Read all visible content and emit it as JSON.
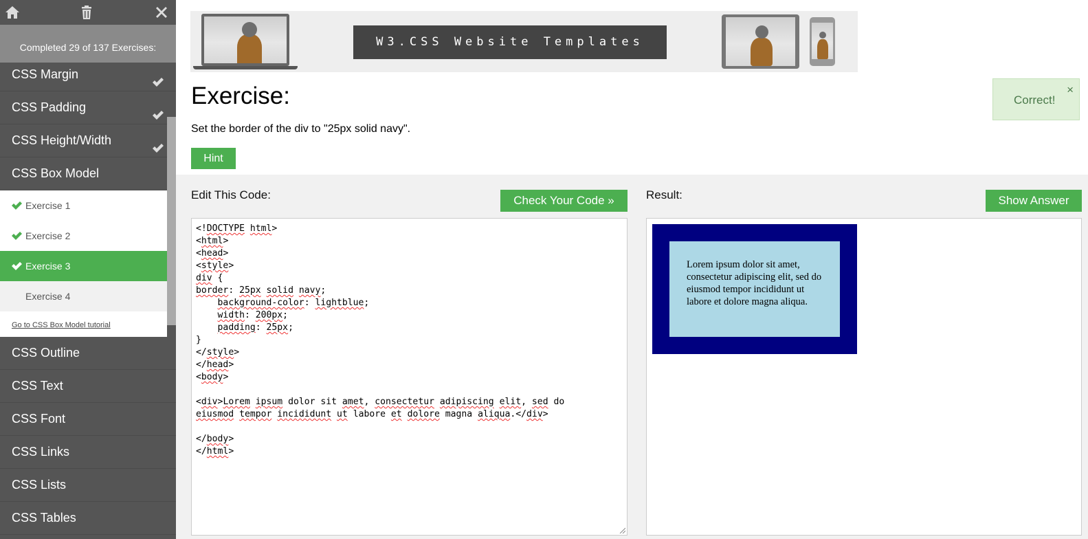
{
  "sidebar": {
    "progress_text": "Completed 29 of 137 Exercises:",
    "categories_top": [
      {
        "label": "CSS Margin",
        "done": true
      },
      {
        "label": "CSS Padding",
        "done": true
      },
      {
        "label": "CSS Height/Width",
        "done": true
      },
      {
        "label": "CSS Box Model",
        "done": false
      }
    ],
    "exercises": [
      {
        "label": "Exercise 1",
        "done": true
      },
      {
        "label": "Exercise 2",
        "done": true
      },
      {
        "label": "Exercise 3",
        "done": true,
        "current": true
      },
      {
        "label": "Exercise 4",
        "done": false
      }
    ],
    "tutorial_link": "Go to CSS Box Model tutorial",
    "categories_bottom": [
      {
        "label": "CSS Outline"
      },
      {
        "label": "CSS Text"
      },
      {
        "label": "CSS Font"
      },
      {
        "label": "CSS Links"
      },
      {
        "label": "CSS Lists"
      },
      {
        "label": "CSS Tables"
      }
    ]
  },
  "banner": {
    "title": "W3.CSS Website Templates"
  },
  "exercise": {
    "heading": "Exercise:",
    "description": "Set the border of the div to \"25px solid navy\".",
    "hint_label": "Hint"
  },
  "toast": {
    "text": "Correct!",
    "close": "×"
  },
  "editor": {
    "label": "Edit This Code:",
    "check_label": "Check Your Code »",
    "code_lines": [
      "<!DOCTYPE html>",
      "<html>",
      "<head>",
      "<style>",
      "div {",
      "border: 25px solid navy;",
      "    background-color: lightblue;",
      "    width: 200px;",
      "    padding: 25px;",
      "}",
      "</style>",
      "</head>",
      "<body>",
      "",
      "<div>Lorem ipsum dolor sit amet, consectetur adipiscing elit, sed do",
      "eiusmod tempor incididunt ut labore et dolore magna aliqua.</div>",
      "",
      "</body>",
      "</html>"
    ]
  },
  "result": {
    "label": "Result:",
    "answer_label": "Show Answer",
    "div_text": "Lorem ipsum dolor sit amet, consectetur adipiscing elit, sed do eiusmod tempor incididunt ut labore et dolore magna aliqua."
  },
  "colors": {
    "accent_green": "#4CAF50",
    "sidebar_bg": "#555555",
    "demo_border": "navy",
    "demo_bg": "lightblue"
  }
}
